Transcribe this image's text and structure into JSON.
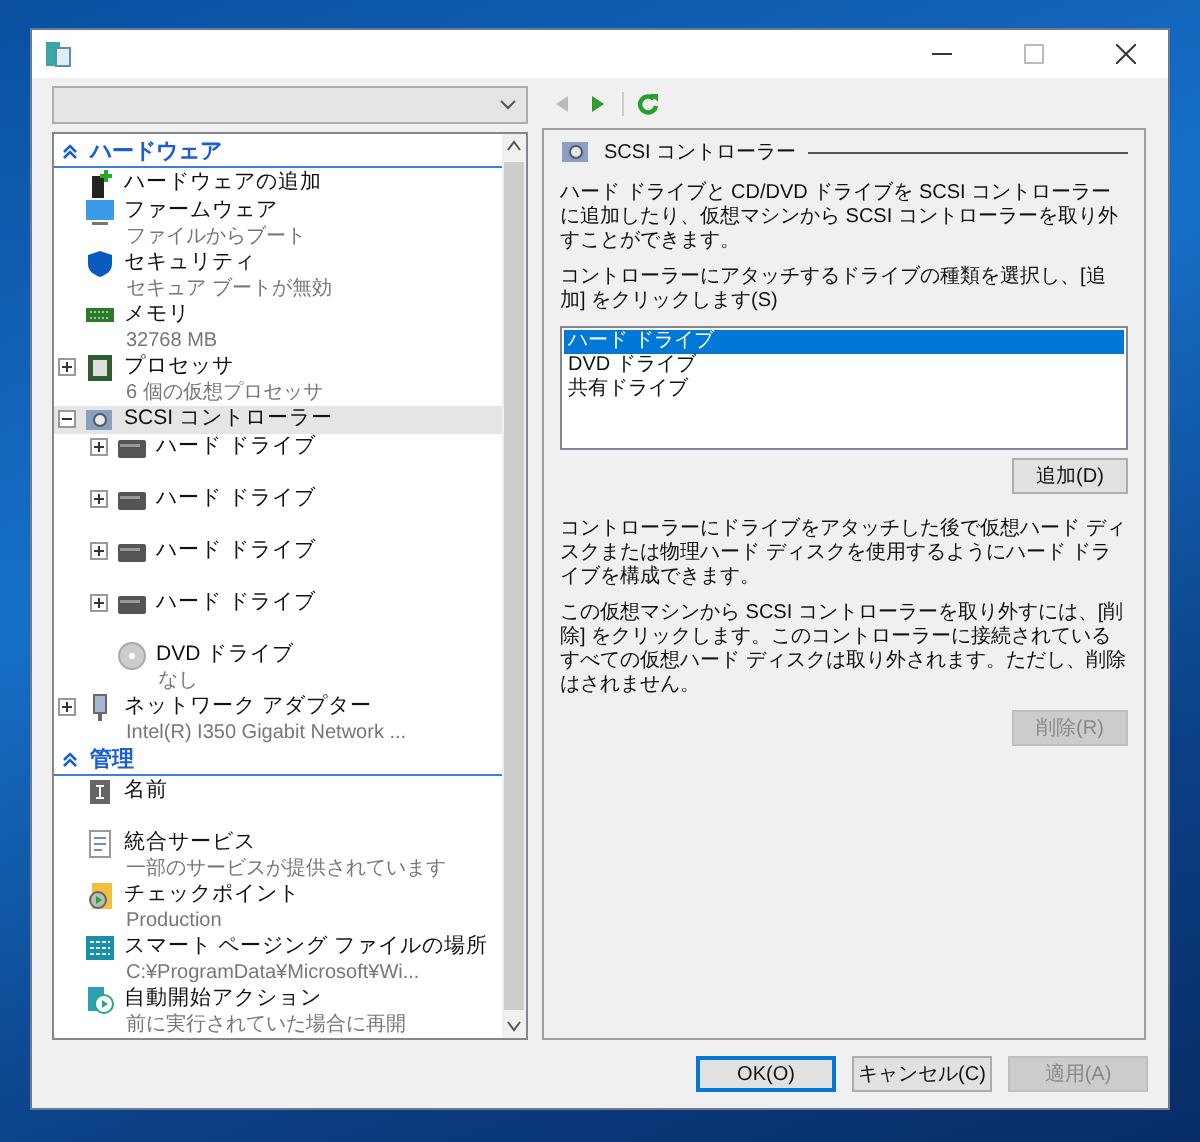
{
  "toolbar": [
    {
      "kind": "back",
      "disabled": true
    },
    {
      "kind": "forward",
      "disabled": false
    },
    {
      "kind": "refresh",
      "disabled": false
    }
  ],
  "tree": [
    {
      "title": "ハードウェア",
      "expanded": true,
      "items": [
        {
          "kind": "hardware-add",
          "label": "ハードウェアの追加",
          "selected": false
        },
        {
          "kind": "firmware",
          "label": "ファームウェア",
          "sub": "ファイルからブート",
          "selected": false
        },
        {
          "kind": "security",
          "label": "セキュリティ",
          "sub": "セキュア ブートが無効",
          "selected": false
        },
        {
          "kind": "memory",
          "label": "メモリ",
          "sub": "32768 MB",
          "selected": false
        },
        {
          "kind": "processor",
          "label": "プロセッサ",
          "sub": "6 個の仮想プロセッサ",
          "expanded": false,
          "selected": false
        },
        {
          "kind": "scsi",
          "label": "SCSI コントローラー",
          "expanded": true,
          "selected": true,
          "children": [
            {
              "kind": "disk",
              "label": "ハード ドライブ",
              "expanded": false,
              "selected": false
            },
            {
              "kind": "disk",
              "label": "ハード ドライブ",
              "expanded": false,
              "selected": false
            },
            {
              "kind": "disk",
              "label": "ハード ドライブ",
              "expanded": false,
              "selected": false
            },
            {
              "kind": "disk",
              "label": "ハード ドライブ",
              "expanded": false,
              "selected": false
            },
            {
              "kind": "dvd",
              "label": "DVD ドライブ",
              "sub": "なし",
              "selected": false
            }
          ]
        },
        {
          "kind": "network",
          "label": "ネットワーク アダプター",
          "sub": "Intel(R) I350 Gigabit Network ...",
          "expanded": false,
          "selected": false
        }
      ]
    },
    {
      "title": "管理",
      "expanded": true,
      "items": [
        {
          "kind": "name",
          "label": "名前",
          "selected": false
        },
        {
          "kind": "services",
          "label": "統合サービス",
          "sub": "一部のサービスが提供されています",
          "selected": false
        },
        {
          "kind": "checkpoint",
          "label": "チェックポイント",
          "sub": "Production",
          "selected": false
        },
        {
          "kind": "paging",
          "label": "スマート ページング ファイルの場所",
          "sub": "C:¥ProgramData¥Microsoft¥Wi...",
          "selected": false
        },
        {
          "kind": "autostart",
          "label": "自動開始アクション",
          "sub": "前に実行されていた場合に再開",
          "selected": false
        }
      ]
    }
  ],
  "detail": {
    "title": "SCSI コントローラー",
    "intro": "ハード ドライブと CD/DVD ドライブを SCSI コントローラーに追加したり、仮想マシンから SCSI コントローラーを取り外すことができます。",
    "list_label": "コントローラーにアタッチするドライブの種類を選択し、[追加] をクリックします(S)",
    "drive_types": [
      {
        "label": "ハード ドライブ",
        "selected": true
      },
      {
        "label": "DVD ドライブ",
        "selected": false
      },
      {
        "label": "共有ドライブ",
        "selected": false
      }
    ],
    "add_button": {
      "label": "追加(D)",
      "disabled": false
    },
    "note": "コントローラーにドライブをアタッチした後で仮想ハード ディスクまたは物理ハード ディスクを使用するようにハード ドライブを構成できます。",
    "remove_text": "この仮想マシンから SCSI コントローラーを取り外すには、[削除] をクリックします。このコントローラーに接続されているすべての仮想ハード ディスクは取り外されます。ただし、削除はされません。",
    "remove_button": {
      "label": "削除(R)",
      "disabled": true
    }
  },
  "footer_buttons": [
    {
      "kind": "default",
      "label": "OK(O)",
      "disabled": false
    },
    {
      "kind": "normal",
      "label": "キャンセル(C)",
      "disabled": false
    },
    {
      "kind": "normal",
      "label": "適用(A)",
      "disabled": true
    }
  ]
}
